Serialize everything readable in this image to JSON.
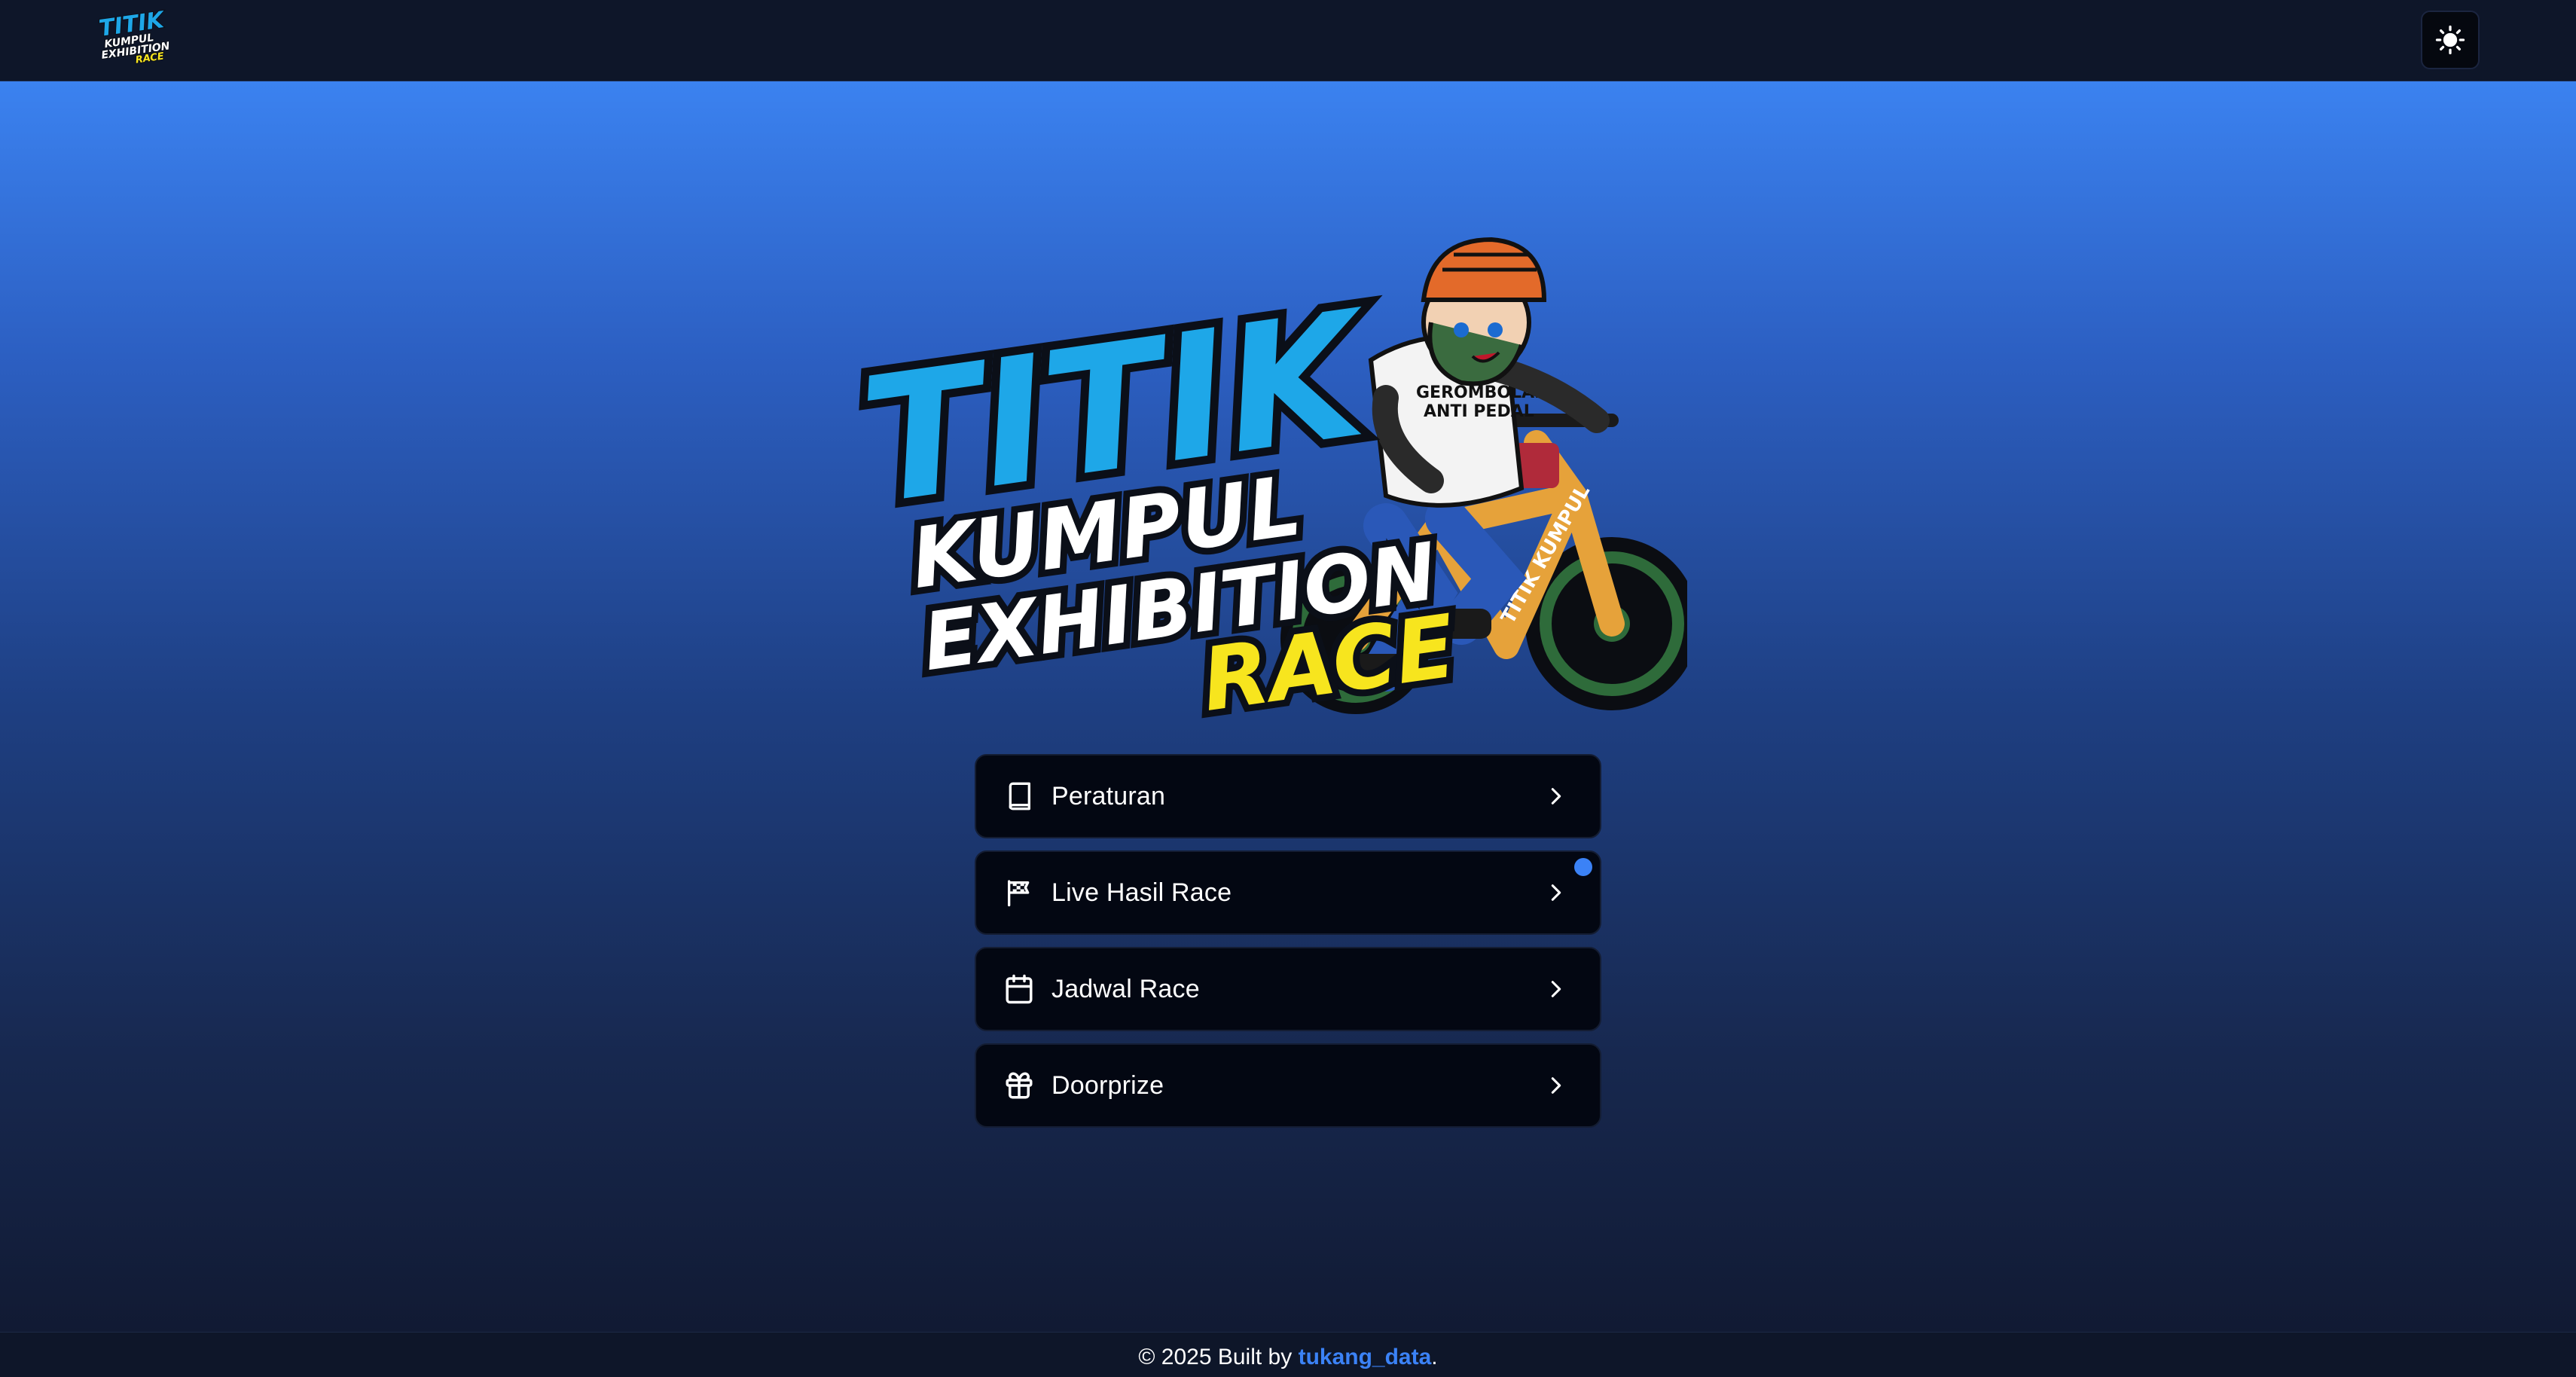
{
  "header": {
    "logo_alt": "TITIK KUMPUL EXHIBITION RACE",
    "theme_toggle_icon": "sun-icon"
  },
  "hero": {
    "logo_line1": "TITIK",
    "logo_line2": "KUMPUL",
    "logo_line3": "EXHIBITION",
    "logo_line4": "RACE",
    "colors": {
      "titik": "#1ea7e8",
      "race": "#f7e51e"
    }
  },
  "menu": [
    {
      "label": "Peraturan",
      "icon": "book-icon"
    },
    {
      "label": "Live Hasil Race",
      "icon": "flag-icon",
      "badge": "live-indicator"
    },
    {
      "label": "Jadwal Race",
      "icon": "calendar-icon"
    },
    {
      "label": "Doorprize",
      "icon": "gift-icon"
    }
  ],
  "footer": {
    "prefix": "© 2025 Built by ",
    "author": "tukang_data",
    "suffix": "."
  },
  "colors": {
    "accent": "#3b82f6",
    "header_bg": "#0e1629",
    "card_bg": "#030712"
  }
}
